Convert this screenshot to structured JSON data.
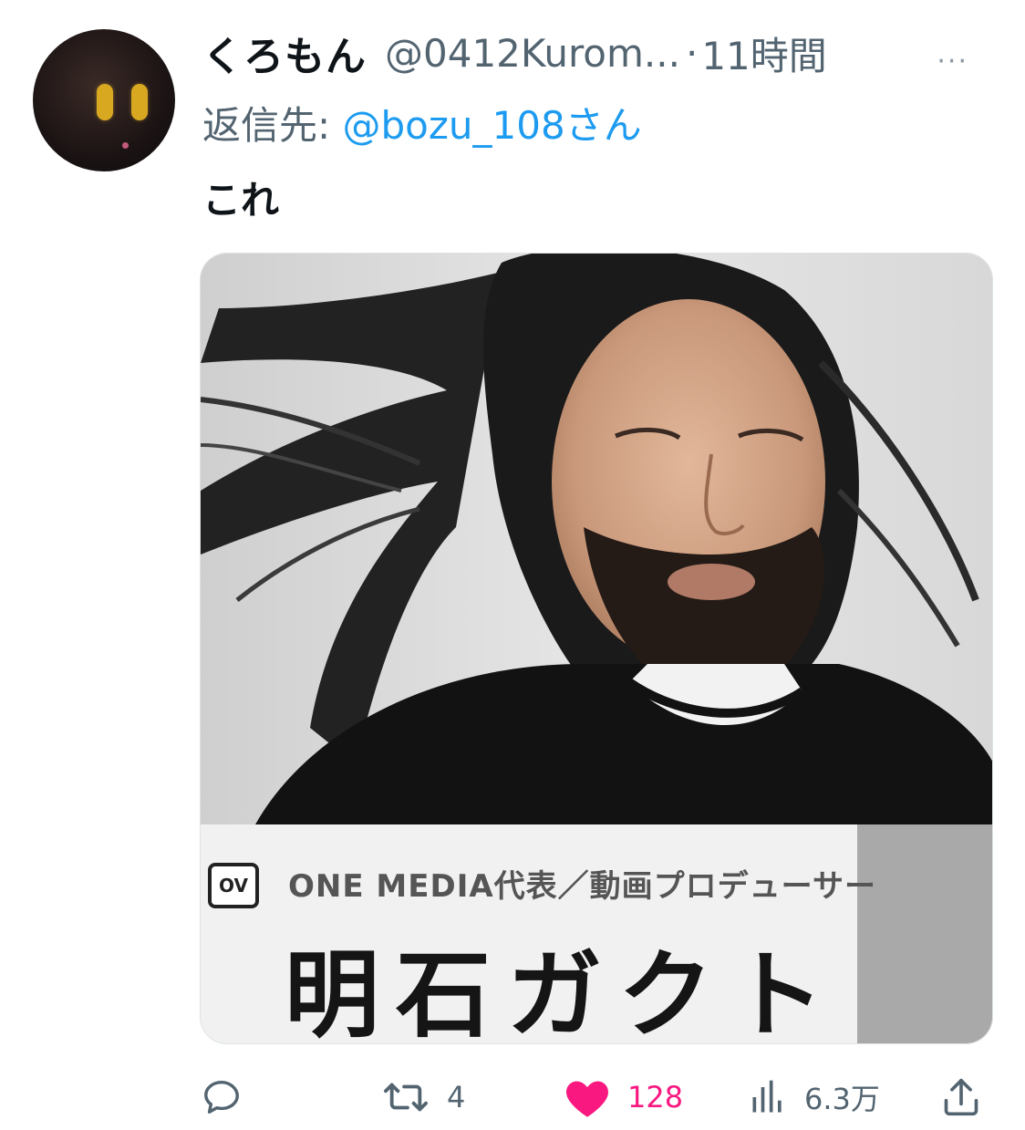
{
  "tweet": {
    "display_name": "くろもん",
    "handle": "@0412Kurom...",
    "separator": "·",
    "time": "11時間",
    "more_label": "···",
    "reply_label": "返信先:",
    "reply_target": "@bozu_108さん",
    "text": "これ"
  },
  "media": {
    "logo_text": "OV",
    "role": "ONE MEDIA代表／動画プロデューサー",
    "name": "明石ガクト"
  },
  "actions": {
    "reply_count": "",
    "retweet_count": "4",
    "like_count": "128",
    "views_count": "6.3万"
  },
  "colors": {
    "accent": "#1d9bf0",
    "like": "#f91880",
    "muted": "#536471"
  }
}
